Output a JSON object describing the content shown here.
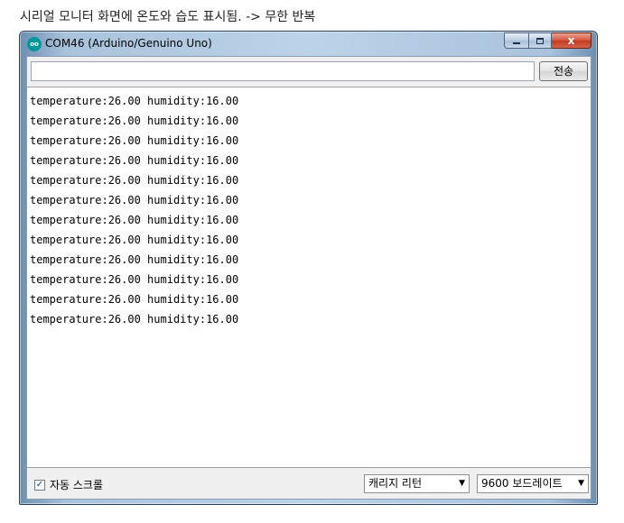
{
  "caption": "시리얼 모니터 화면에 온도와 습도 표시됨. -> 무한 반복",
  "window": {
    "title": "COM46 (Arduino/Genuino Uno)",
    "icon": "arduino-icon",
    "controls": {
      "minimize": "minimize-icon",
      "maximize": "maximize-icon",
      "close": "x"
    }
  },
  "send": {
    "input_value": "",
    "button_label": "전송"
  },
  "output_lines": [
    "temperature:26.00 humidity:16.00",
    "temperature:26.00 humidity:16.00",
    "temperature:26.00 humidity:16.00",
    "temperature:26.00 humidity:16.00",
    "temperature:26.00 humidity:16.00",
    "temperature:26.00 humidity:16.00",
    "temperature:26.00 humidity:16.00",
    "temperature:26.00 humidity:16.00",
    "temperature:26.00 humidity:16.00",
    "temperature:26.00 humidity:16.00",
    "temperature:26.00 humidity:16.00",
    "temperature:26.00 humidity:16.00"
  ],
  "footer": {
    "autoscroll_label": "자동 스크롤",
    "autoscroll_checked": true,
    "line_ending": "캐리지 리턴",
    "baud_rate": "9600 보드레이트"
  },
  "colors": {
    "arduino_teal": "#00979c",
    "close_red": "#c23a1f"
  }
}
